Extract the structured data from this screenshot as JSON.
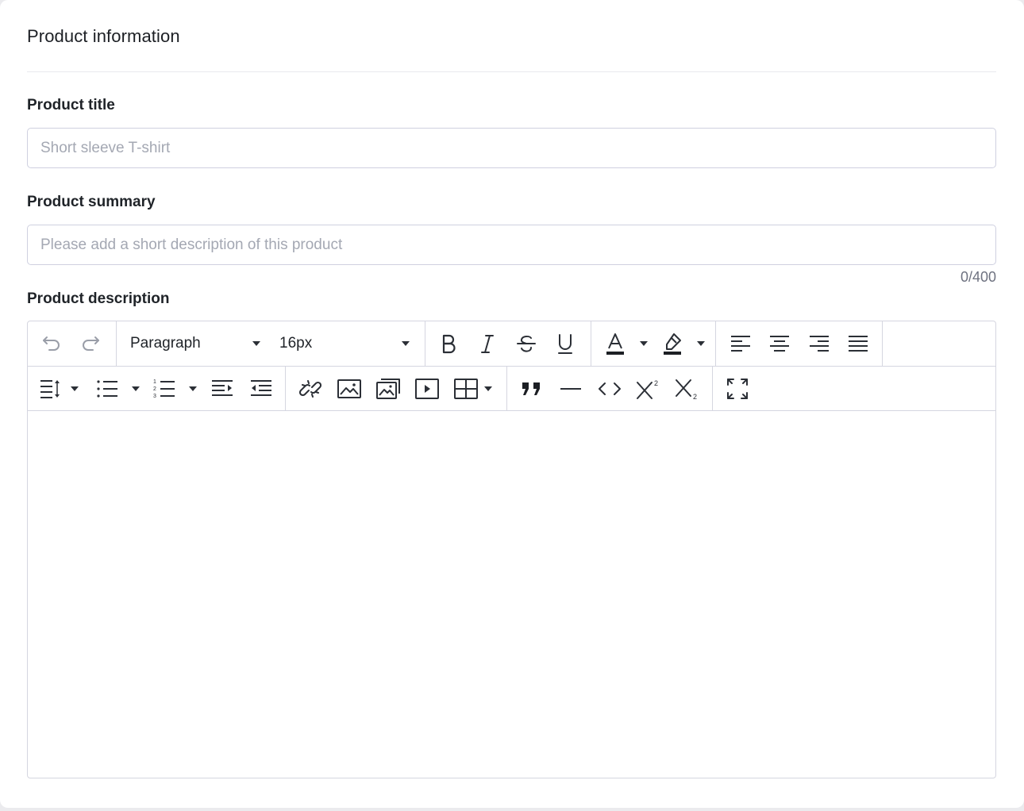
{
  "section": {
    "title": "Product information"
  },
  "fields": {
    "title": {
      "label": "Product title",
      "placeholder": "Short sleeve T-shirt",
      "value": ""
    },
    "summary": {
      "label": "Product summary",
      "placeholder": "Please add a short description of this product",
      "value": "",
      "counter": "0/400"
    },
    "description": {
      "label": "Product description"
    }
  },
  "toolbar": {
    "block_format": "Paragraph",
    "font_size": "16px",
    "row1_icons": [
      "undo-icon",
      "redo-icon",
      "bold-icon",
      "italic-icon",
      "strikethrough-icon",
      "underline-icon",
      "font-color-icon",
      "highlight-icon",
      "align-left-icon",
      "align-center-icon",
      "align-right-icon",
      "align-justify-icon"
    ],
    "row2_icons": [
      "line-height-icon",
      "bullet-list-icon",
      "numbered-list-icon",
      "indent-icon",
      "outdent-icon",
      "link-icon",
      "image-icon",
      "image-gallery-icon",
      "video-icon",
      "table-icon",
      "blockquote-icon",
      "horizontal-rule-icon",
      "code-icon",
      "superscript-icon",
      "subscript-icon",
      "fullscreen-icon"
    ]
  },
  "colors": {
    "border": "#cfd0e0",
    "placeholder": "#a4a8b3",
    "icon": "#2b2f36",
    "icon_disabled": "#9a9ea8"
  }
}
